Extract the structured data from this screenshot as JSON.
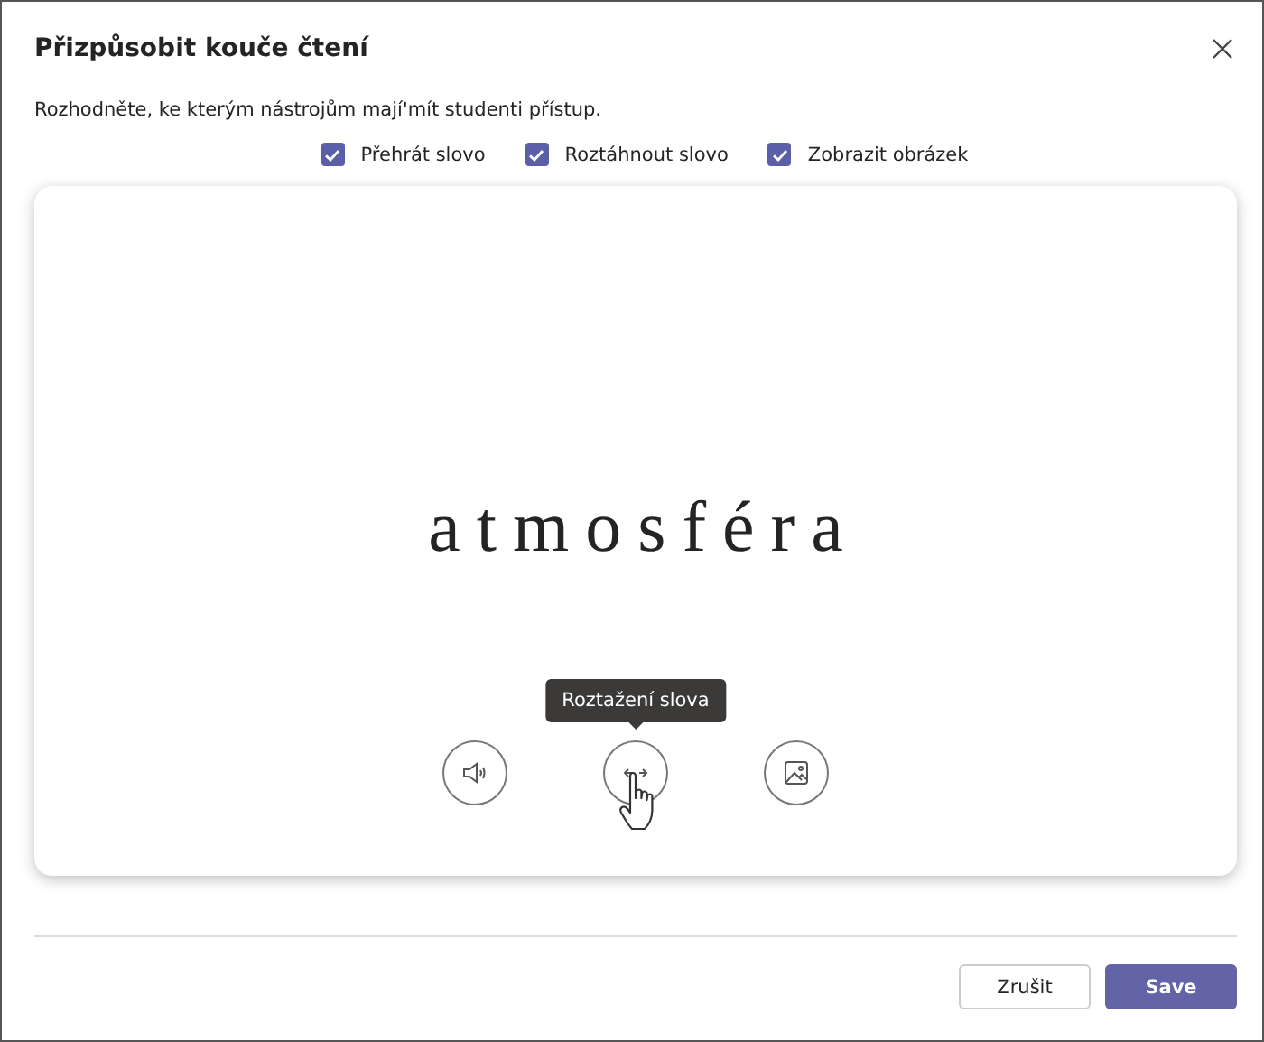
{
  "dialog": {
    "title": "Přizpůsobit kouče čtení",
    "description": "Rozhodněte, ke kterým nástrojům mají'mít studenti přístup."
  },
  "options": [
    {
      "label": "Přehrát slovo",
      "checked": true
    },
    {
      "label": "Roztáhnout slovo",
      "checked": true
    },
    {
      "label": "Zobrazit obrázek",
      "checked": true
    }
  ],
  "preview": {
    "word": "atmosféra",
    "tooltip": "Roztažení slova",
    "tools": [
      {
        "kind": "sound",
        "hovered": false
      },
      {
        "kind": "stretch",
        "hovered": true
      },
      {
        "kind": "image",
        "hovered": false
      }
    ]
  },
  "buttons": [
    {
      "label": "Zrušit",
      "kind": "secondary"
    },
    {
      "label": "Save",
      "kind": "primary"
    }
  ]
}
